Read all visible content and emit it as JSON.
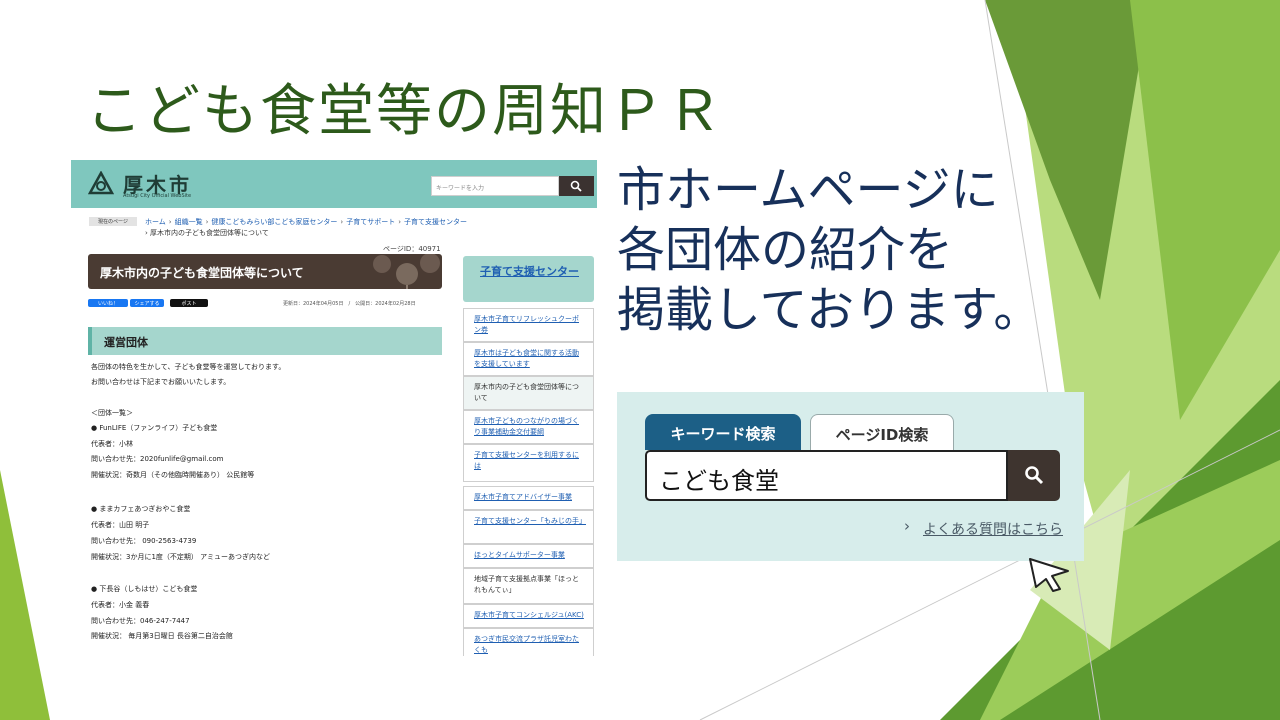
{
  "slide": {
    "title": "こども食堂等の周知ＰＲ",
    "body_lines": [
      "市ホームページに",
      "各団体の紹介を",
      "掲載しております。"
    ]
  },
  "website": {
    "logo_text": "厚木市",
    "logo_sub": "Atsugi City Official WebSite",
    "search_placeholder": "キーワードを入力",
    "breadcrumb_label": "現在のページ",
    "breadcrumb": [
      "ホーム",
      "組織一覧",
      "健康こどもみらい部こども家庭センター",
      "子育てサポート",
      "子育て支援センター"
    ],
    "breadcrumb_current": "厚木市内の子ども食堂団体等について",
    "page_id": "ページID：40971",
    "page_title": "厚木市内の子ども食堂団体等について",
    "share_facebook": "いいね！",
    "share_share": "シェアする",
    "share_post": "ポスト",
    "dates": "更新日：2024年04月05日　/　公開日：2024年02月28日",
    "section_title": "運営団体",
    "body": [
      "各団体の特色を生かして、子ども食堂等を運営しております。",
      "お問い合わせは下記までお願いいたします。",
      "＜団体一覧＞",
      "● FunLIFE（ファンライフ）子ども食堂",
      "代表者：小林",
      "問い合わせ先：2020funlife@gmail.com",
      "開催状況：奇数月（その他臨時開催あり） 公民館等",
      "● ままカフェあつぎおやこ食堂",
      "代表者：山田 明子",
      "問い合わせ先： 090-2563-4739",
      "開催状況：3か月に1度（不定期） アミューあつぎ内など",
      "● 下長谷（しもはせ）こども食堂",
      "代表者：小金 義春",
      "問い合わせ先：046-247-7447",
      "開催状況： 毎月第3日曜日 長谷第二自治会館"
    ],
    "sidebar_heading": "子育て支援センター",
    "sidebar_items": [
      "厚木市子育てリフレッシュクーポン券",
      "厚木市は子ども食堂に関する活動を支援しています",
      "厚木市内の子ども食堂団体等について",
      "厚木市子どものつながりの場づくり事業補助金交付要綱",
      "子育て支援センターを利用するには",
      "厚木市子育てアドバイザー事業",
      "子育て支援センター「もみじの手」",
      "ほっとタイムサポーター事業",
      "地域子育て支援拠点事業「ほっとれもんてぃ」",
      "厚木市子育てコンシェルジュ(AKC)",
      "あつぎ市民交流プラザ託児室わたくも"
    ]
  },
  "search_widget": {
    "tab_keyword": "キーワード検索",
    "tab_pageid": "ページID検索",
    "query": "こども食堂",
    "faq_chevron": "›",
    "faq_link": "よくある質問はこちら"
  },
  "colors": {
    "title_green": "#2d5a1b",
    "body_navy": "#17305a",
    "site_teal": "#7fc7be",
    "tab_blue": "#1c5f86"
  }
}
